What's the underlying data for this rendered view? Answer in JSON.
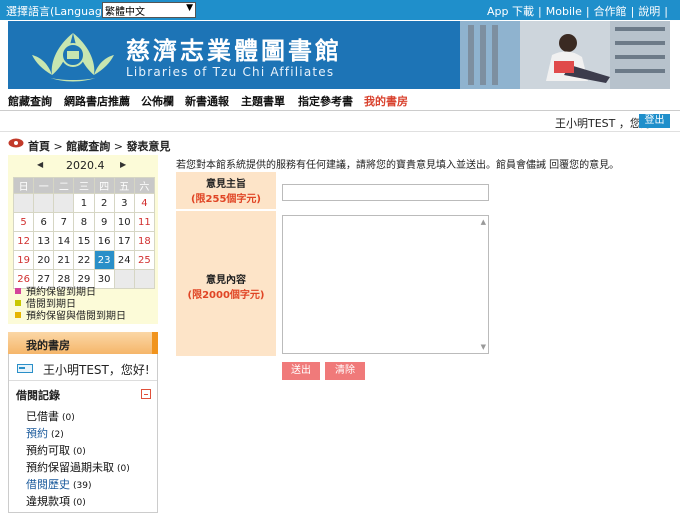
{
  "topbar": {
    "lang_label": "選擇語言(Language) :",
    "lang_selected": "繁體中文",
    "links": [
      "App 下載",
      "Mobile",
      "合作館",
      "說明"
    ]
  },
  "banner": {
    "title_cn": "慈濟志業體圖書館",
    "title_en": "Libraries of Tzu Chi Affiliates"
  },
  "nav": {
    "items": [
      "館藏查詢",
      "網路書店推薦",
      "公佈欄",
      "新書通報",
      "主題書單",
      "指定參考書",
      "我的書房"
    ]
  },
  "user": {
    "greeting": "王小明TEST ，您好",
    "logout": "登出"
  },
  "breadcrumb": {
    "home": "首頁",
    "sep": " > ",
    "level1": "館藏查詢",
    "current": "發表意見"
  },
  "calendar": {
    "prev": "◀",
    "next": "▶",
    "title": "2020.4",
    "weekdays": [
      "日",
      "一",
      "二",
      "三",
      "四",
      "五",
      "六"
    ],
    "days": [
      "",
      "",
      "",
      "1",
      "2",
      "3",
      "4",
      "5",
      "6",
      "7",
      "8",
      "9",
      "10",
      "11",
      "12",
      "13",
      "14",
      "15",
      "16",
      "17",
      "18",
      "19",
      "20",
      "21",
      "22",
      "23",
      "24",
      "25",
      "26",
      "27",
      "28",
      "29",
      "30",
      "",
      ""
    ],
    "today": "23",
    "legend": [
      {
        "label": "預約保留到期日",
        "color": "#d4449a"
      },
      {
        "label": "借閱到期日",
        "color": "#c8c800"
      },
      {
        "label": "預約保留與借閱到期日",
        "color": "#e6b400"
      }
    ]
  },
  "mylib": {
    "title": "我的書房",
    "greeting": "王小明TEST，您好!",
    "borrow_title": "借閱記錄",
    "items": [
      {
        "label": "已借書",
        "count": "(0)"
      },
      {
        "label": "預約",
        "count": "(2)"
      },
      {
        "label": "預約可取",
        "count": "(0)"
      },
      {
        "label": "預約保留過期未取",
        "count": "(0)"
      },
      {
        "label": "借閱歷史",
        "count": "(39)"
      },
      {
        "label": "違規款項",
        "count": "(0)"
      }
    ]
  },
  "form": {
    "intro": "若您對本館系統提供的服務有任何建議，請將您的寶貴意見填入並送出。館員會儘誡 回覆您的意見。",
    "subject_label": "意見主旨",
    "subject_limit": "(限255個字元)",
    "subject_value": "",
    "content_label": "意見內容",
    "content_limit": "(限2000個字元)",
    "content_value": "",
    "submit": "送出",
    "clear": "清除"
  },
  "colors": {
    "topbar": "#1f8fcb",
    "banner": "#1d74b6",
    "active_nav": "#d9422e",
    "label_bg": "#fde4c8",
    "limit_text": "#e04525",
    "button": "#f07a7a"
  }
}
